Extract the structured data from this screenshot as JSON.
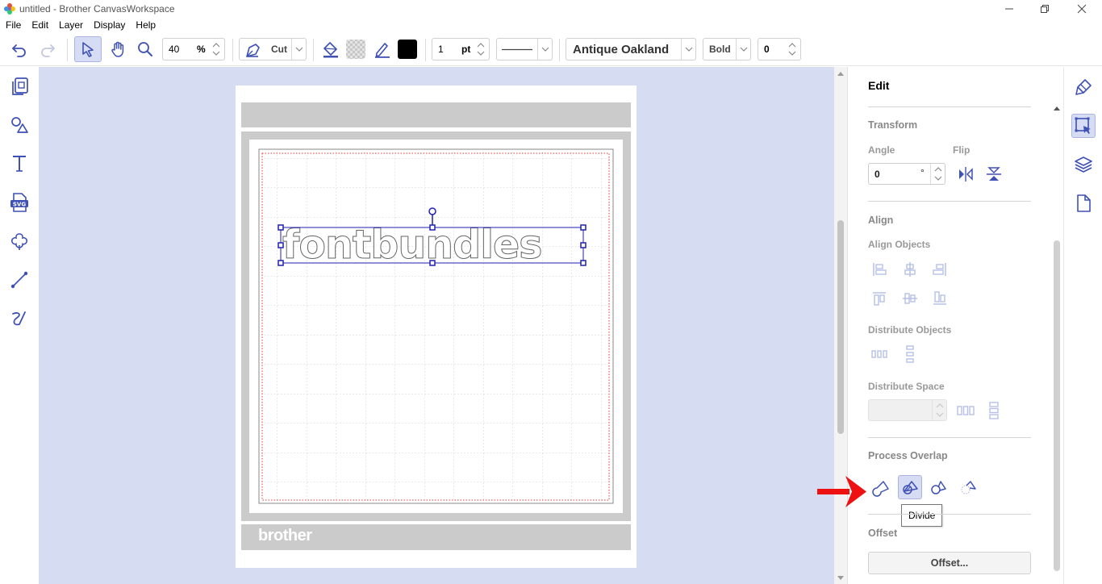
{
  "window": {
    "title": "untitled - Brother CanvasWorkspace"
  },
  "menu": [
    "File",
    "Edit",
    "Layer",
    "Display",
    "Help"
  ],
  "toolbar": {
    "zoom_value": "40",
    "zoom_unit": "%",
    "line_mode": "Cut",
    "fill_color": "#000000",
    "line_width_value": "1",
    "line_width_unit": "pt",
    "font_name": "Antique Oakland",
    "font_style": "Bold",
    "letter_spacing": "0"
  },
  "canvas": {
    "text_object": "fontbundles",
    "mat_brand": "brother"
  },
  "panel": {
    "title": "Edit",
    "transform": {
      "heading": "Transform",
      "angle_label": "Angle",
      "angle_value": "0",
      "angle_unit": "°",
      "flip_label": "Flip"
    },
    "align": {
      "heading": "Align",
      "align_objects_label": "Align Objects",
      "distribute_objects_label": "Distribute Objects",
      "distribute_space_label": "Distribute Space"
    },
    "process_overlap": {
      "heading": "Process Overlap",
      "tooltip": "Divide"
    },
    "offset": {
      "heading": "Offset",
      "button_label": "Offset..."
    }
  },
  "colors": {
    "accent": "#3f51b5",
    "canvas_bg": "#d6ddf2",
    "annotation_arrow": "#ee1111"
  }
}
